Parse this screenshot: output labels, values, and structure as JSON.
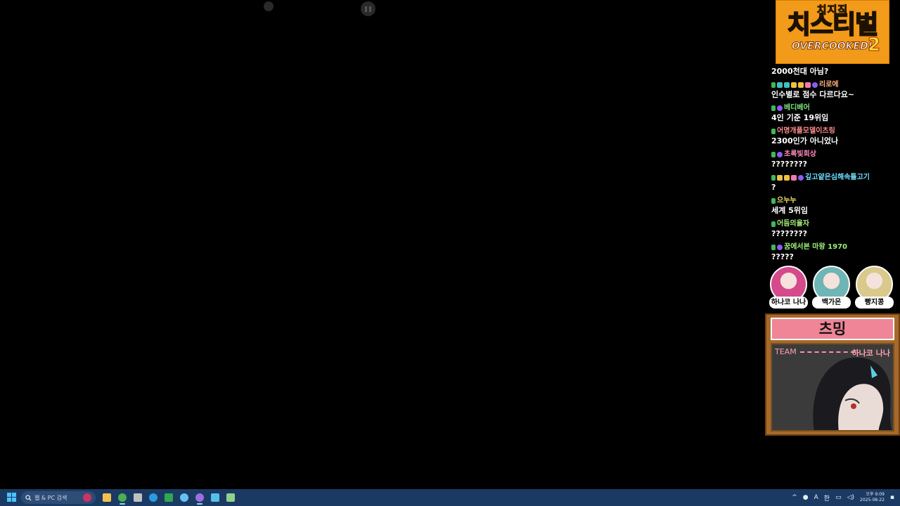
{
  "event_logo": {
    "top_text": "치지직",
    "main_text": "치스티벌",
    "sub_text": "OVERCOOKED!",
    "sub_number": "2"
  },
  "chat": {
    "first_message": "2000천대 아님?",
    "entries": [
      {
        "user": "리로에",
        "user_color": "#ffb07a",
        "badges": [
          "green",
          "teal",
          "teal",
          "yellow",
          "yellow",
          "pink",
          "purple"
        ],
        "text": "인수별로 점수 다르다요~"
      },
      {
        "user": "베디베어",
        "user_color": "#7de27d",
        "badges": [
          "green",
          "purple"
        ],
        "text": "4인 기준 19위임"
      },
      {
        "user": "어명개플모델이츠링",
        "user_color": "#ff8c8c",
        "badges": [
          "green"
        ],
        "text": "2300인가 아니었나"
      },
      {
        "user": "초록빛회상",
        "user_color": "#ff8cba",
        "badges": [
          "green",
          "purple"
        ],
        "text": "????????"
      },
      {
        "user": "깊고얕은심해속틀고기",
        "user_color": "#6ee0ff",
        "badges": [
          "green",
          "yellow",
          "yellow",
          "pink",
          "purple"
        ],
        "text": "?"
      },
      {
        "user": "으누누",
        "user_color": "#f5e36a",
        "badges": [
          "green"
        ],
        "text": "세계 5위임"
      },
      {
        "user": "어듬의율자",
        "user_color": "#a9f07a",
        "badges": [
          "green"
        ],
        "text": "????????"
      },
      {
        "user": "꿈에서본 마왕 1970",
        "user_color": "#9ef07a",
        "badges": [
          "green",
          "purple"
        ],
        "text": "?????"
      }
    ]
  },
  "members": [
    {
      "name": "하나코 나나",
      "color": "#d44a8a"
    },
    {
      "name": "백가은",
      "color": "#6fb5b5"
    },
    {
      "name": "빵지콩",
      "color": "#d9c98a"
    }
  ],
  "team_card": {
    "title": "츠밍",
    "label": "TEAM",
    "member": "하나코 나나"
  },
  "taskbar": {
    "search_placeholder": "웹 & PC 검색",
    "apps": [
      "file-explorer",
      "chrome",
      "app-a",
      "edge",
      "app-green",
      "steam",
      "app-purple",
      "notepad",
      "app-gallery"
    ],
    "tray_lang": "A",
    "tray_ime": "한",
    "clock_time": "오후 9:09",
    "clock_date": "2025-08-22"
  }
}
